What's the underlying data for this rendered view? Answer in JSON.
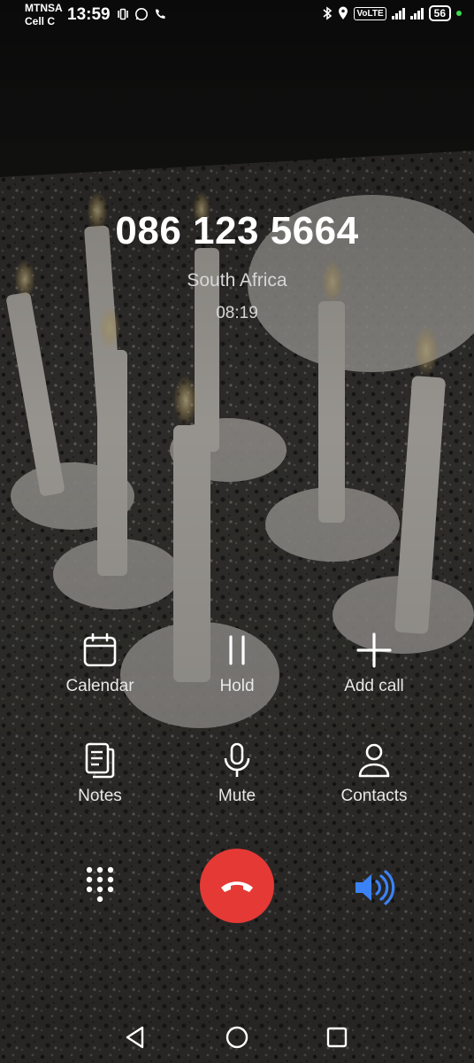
{
  "status_bar": {
    "carrier_1": "MTNSA",
    "carrier_2": "Cell C",
    "time": "13:59",
    "volte": "VoLTE",
    "battery": "56"
  },
  "call": {
    "number": "086 123 5664",
    "location": "South Africa",
    "duration": "08:19"
  },
  "actions": {
    "calendar": "Calendar",
    "hold": "Hold",
    "add_call": "Add call",
    "notes": "Notes",
    "mute": "Mute",
    "contacts": "Contacts"
  },
  "colors": {
    "end_call": "#e53935",
    "speaker_active": "#3b82f6"
  }
}
